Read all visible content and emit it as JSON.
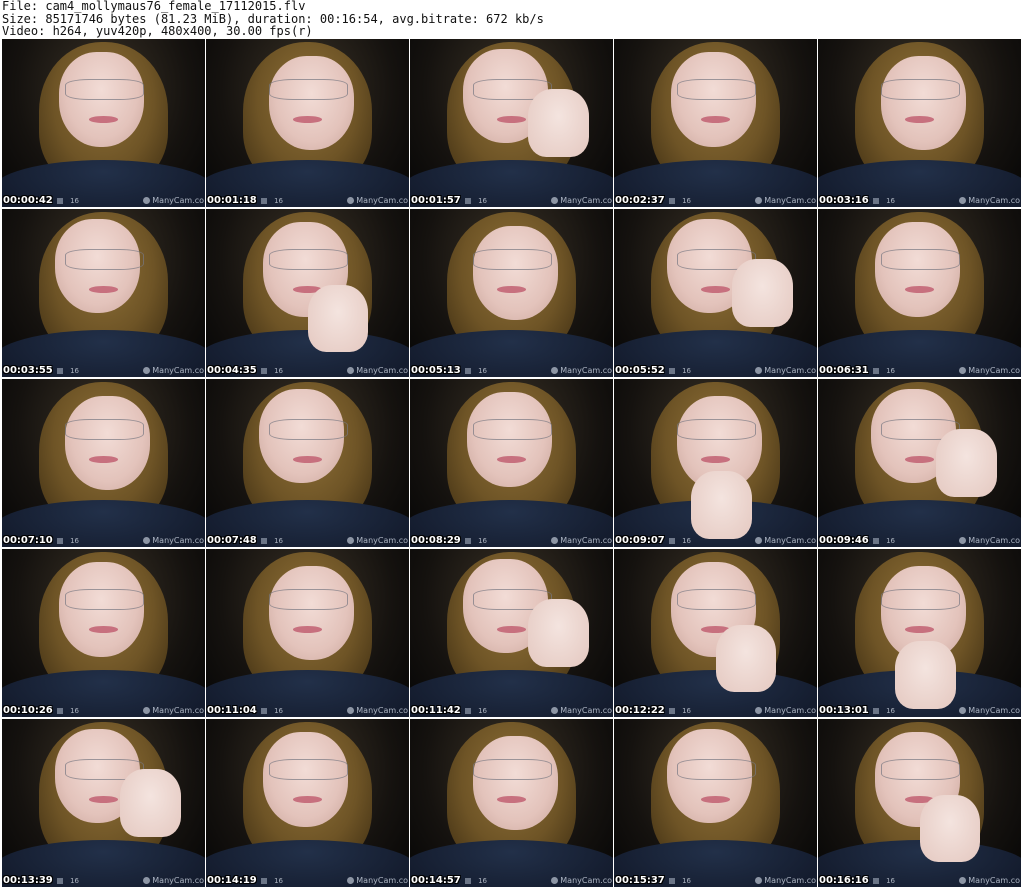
{
  "header": {
    "line1": "File: cam4_mollymaus76_female_17112015.flv",
    "line2": "Size: 85171746 bytes (81.23 MiB), duration: 00:16:54, avg.bitrate: 672 kb/s",
    "line3": "Video: h264, yuv420p, 480x400, 30.00 fps(r)"
  },
  "thumb_badge": "16",
  "watermark": "ManyCam.co",
  "thumbnails": [
    {
      "time": "00:00:42",
      "hand": false
    },
    {
      "time": "00:01:18",
      "hand": false
    },
    {
      "time": "00:01:57",
      "hand": true
    },
    {
      "time": "00:02:37",
      "hand": false
    },
    {
      "time": "00:03:16",
      "hand": false
    },
    {
      "time": "00:03:55",
      "hand": false
    },
    {
      "time": "00:04:35",
      "hand": true
    },
    {
      "time": "00:05:13",
      "hand": false
    },
    {
      "time": "00:05:52",
      "hand": true
    },
    {
      "time": "00:06:31",
      "hand": false
    },
    {
      "time": "00:07:10",
      "hand": false
    },
    {
      "time": "00:07:48",
      "hand": false
    },
    {
      "time": "00:08:29",
      "hand": false
    },
    {
      "time": "00:09:07",
      "hand": true
    },
    {
      "time": "00:09:46",
      "hand": true
    },
    {
      "time": "00:10:26",
      "hand": false
    },
    {
      "time": "00:11:04",
      "hand": false
    },
    {
      "time": "00:11:42",
      "hand": true
    },
    {
      "time": "00:12:22",
      "hand": true
    },
    {
      "time": "00:13:01",
      "hand": true
    },
    {
      "time": "00:13:39",
      "hand": true
    },
    {
      "time": "00:14:19",
      "hand": false
    },
    {
      "time": "00:14:57",
      "hand": false
    },
    {
      "time": "00:15:37",
      "hand": false
    },
    {
      "time": "00:16:16",
      "hand": true
    }
  ]
}
